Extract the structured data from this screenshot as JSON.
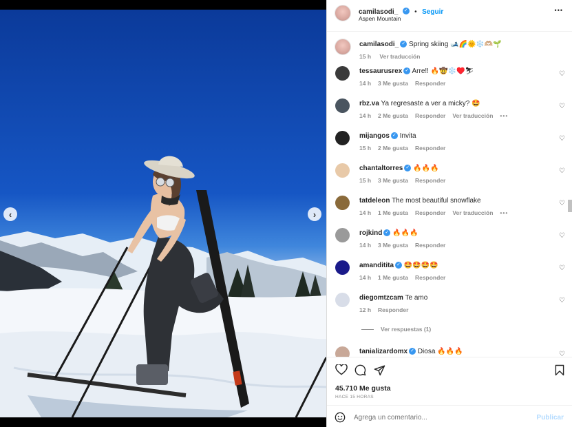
{
  "post": {
    "author": "camilasodi_",
    "follow_label": "Seguir",
    "location": "Aspen Mountain",
    "more_label": "•••"
  },
  "caption": {
    "user": "camilasodi_",
    "text": "Spring skiing 🎿🌈🌞❄️🫶🏼🌱",
    "time": "15 h",
    "translate": "Ver traducción"
  },
  "comments": [
    {
      "user": "tessaurusrex",
      "verified": true,
      "text": "Arre!! 🔥🤠❄️♥️⛷",
      "time": "14 h",
      "likes": "3 Me gusta",
      "reply": "Responder",
      "translate": "",
      "avatar": "#3a3a3a"
    },
    {
      "user": "rbz.va",
      "verified": false,
      "text": "Ya regresaste a ver a micky? 🤩",
      "time": "14 h",
      "likes": "2 Me gusta",
      "reply": "Responder",
      "translate": "Ver traducción",
      "avatar": "#4a5560"
    },
    {
      "user": "mijangos",
      "verified": true,
      "text": "Invita",
      "time": "15 h",
      "likes": "2 Me gusta",
      "reply": "Responder",
      "translate": "",
      "avatar": "#222222"
    },
    {
      "user": "chantaltorres",
      "verified": true,
      "text": "🔥🔥🔥",
      "time": "15 h",
      "likes": "3 Me gusta",
      "reply": "Responder",
      "translate": "",
      "avatar": "#e8c9a8"
    },
    {
      "user": "tatdeleon",
      "verified": false,
      "text": "The most beautiful snowflake",
      "time": "14 h",
      "likes": "1 Me gusta",
      "reply": "Responder",
      "translate": "Ver traducción",
      "avatar": "#8a6a3a"
    },
    {
      "user": "rojkind",
      "verified": true,
      "text": "🔥🔥🔥",
      "time": "14 h",
      "likes": "3 Me gusta",
      "reply": "Responder",
      "translate": "",
      "avatar": "#9a9a9a"
    },
    {
      "user": "amanditita",
      "verified": true,
      "text": "🤩🤩🤩🤩",
      "time": "14 h",
      "likes": "1 Me gusta",
      "reply": "Responder",
      "translate": "",
      "avatar": "#1a1a8a"
    },
    {
      "user": "diegomtzcam",
      "verified": false,
      "text": "Te amo",
      "time": "12 h",
      "likes": "",
      "reply": "Responder",
      "translate": "",
      "avatar": "#d8dde8"
    }
  ],
  "view_replies": "Ver respuestas (1)",
  "last_comment": {
    "user": "tanializardomx",
    "verified": true,
    "text": "Diosa 🔥🔥🔥"
  },
  "likes_count": "45.710 Me gusta",
  "time_ago": "HACE 15 HORAS",
  "add_comment": {
    "placeholder": "Agrega un comentario...",
    "publish": "Publicar"
  },
  "colors": {
    "accent": "#0095f6",
    "publish_disabled": "#b3dbff",
    "verified": "#3897f0"
  }
}
